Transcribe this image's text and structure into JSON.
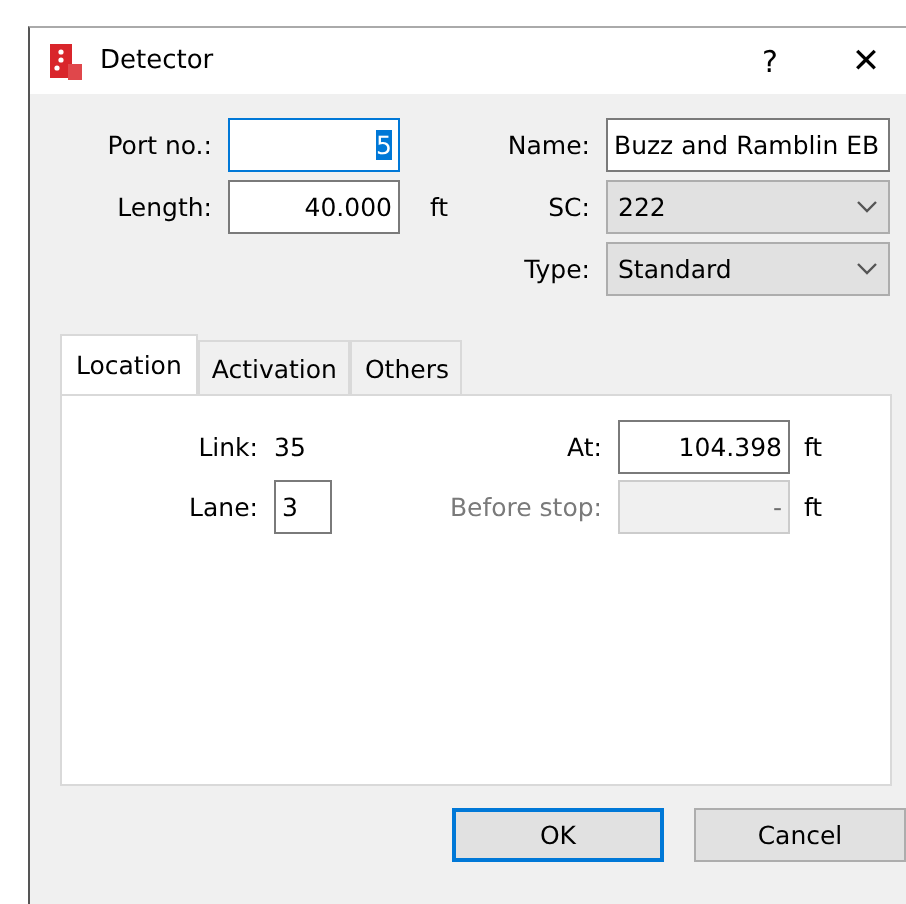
{
  "window": {
    "title": "Detector",
    "help": "?",
    "close": "✕"
  },
  "fields": [
    {
      "kind": "input",
      "label": "Port no.:",
      "value": "5",
      "text_selected": true,
      "focused": true
    },
    {
      "kind": "combo",
      "label": "Name:",
      "value": "Buzz and Ramblin EB",
      "editable": true
    },
    {
      "kind": "input",
      "label": "Length:",
      "value": "40.000",
      "unit": "ft",
      "text_selected": false,
      "focused": false
    },
    {
      "kind": "combo",
      "label": "SC:",
      "value": "222",
      "editable": false
    },
    {
      "kind": "blank"
    },
    {
      "kind": "combo",
      "label": "Type:",
      "value": "Standard",
      "editable": false
    }
  ],
  "tabs": [
    {
      "label": "Location",
      "selected": true
    },
    {
      "label": "Activation",
      "selected": false
    },
    {
      "label": "Others",
      "selected": false
    }
  ],
  "location": [
    {
      "kind": "text",
      "label": "Link:",
      "value": "35"
    },
    {
      "kind": "input",
      "label": "At:",
      "value": "104.398",
      "unit": "ft",
      "disabled": false
    },
    {
      "kind": "input",
      "label": "Lane:",
      "value": "3",
      "disabled": false,
      "small": true
    },
    {
      "kind": "input",
      "label": "Before stop:",
      "value": "-",
      "unit": "ft",
      "disabled": true
    }
  ],
  "buttons": [
    {
      "label": "OK",
      "default": true
    },
    {
      "label": "Cancel",
      "default": false
    }
  ]
}
